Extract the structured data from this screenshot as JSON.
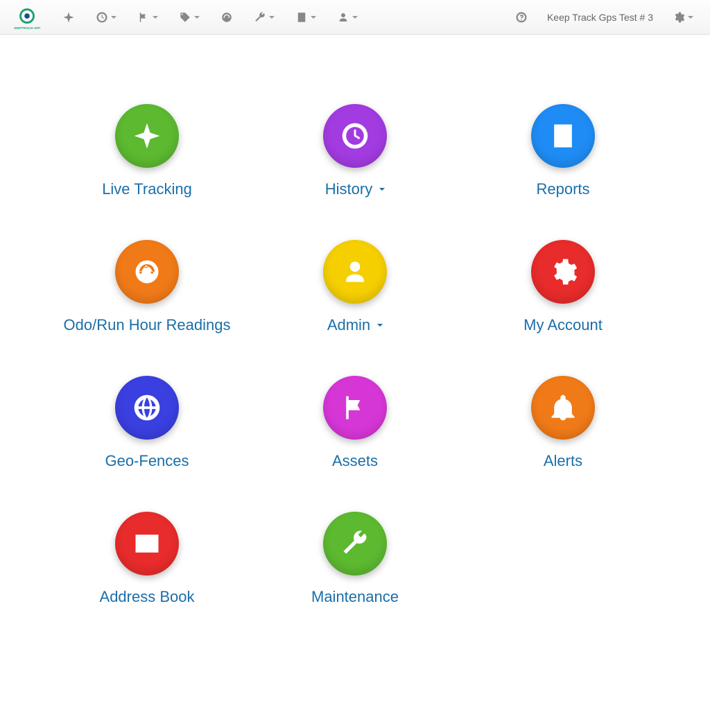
{
  "navbar": {
    "account_label": "Keep Track Gps Test # 3",
    "icons": {
      "tracking": "crosshair-icon",
      "history": "clock-icon",
      "alerts": "flag-icon",
      "assets": "tag-icon",
      "odo": "gauge-icon",
      "maint": "wrench-icon",
      "reports": "report-icon",
      "admin": "person-icon",
      "help": "help-icon",
      "settings": "gear-icon"
    }
  },
  "tiles": [
    {
      "id": "live-tracking",
      "label": "Live Tracking",
      "icon": "crosshair-icon",
      "color": "#5cb930",
      "dropdown": false
    },
    {
      "id": "history",
      "label": "History",
      "icon": "clock-icon",
      "color": "#a23be0",
      "dropdown": true
    },
    {
      "id": "reports",
      "label": "Reports",
      "icon": "report-icon",
      "color": "#1e8cf4",
      "dropdown": false
    },
    {
      "id": "odo",
      "label": "Odo/Run Hour Readings",
      "icon": "gauge-icon",
      "color": "#f07a18",
      "dropdown": false
    },
    {
      "id": "admin",
      "label": "Admin",
      "icon": "person-icon",
      "color": "#f5cf00",
      "dropdown": true
    },
    {
      "id": "my-account",
      "label": "My Account",
      "icon": "gear-icon",
      "color": "#e82b2b",
      "dropdown": false
    },
    {
      "id": "geo-fences",
      "label": "Geo-Fences",
      "icon": "globe-icon",
      "color": "#3a3fe0",
      "dropdown": false
    },
    {
      "id": "assets",
      "label": "Assets",
      "icon": "flag-icon",
      "color": "#d736d7",
      "dropdown": false
    },
    {
      "id": "alerts",
      "label": "Alerts",
      "icon": "bell-icon",
      "color": "#f07a18",
      "dropdown": false
    },
    {
      "id": "address-book",
      "label": "Address Book",
      "icon": "mail-icon",
      "color": "#e82b2b",
      "dropdown": false
    },
    {
      "id": "maintenance",
      "label": "Maintenance",
      "icon": "wrench-icon",
      "color": "#5cb930",
      "dropdown": false
    }
  ]
}
